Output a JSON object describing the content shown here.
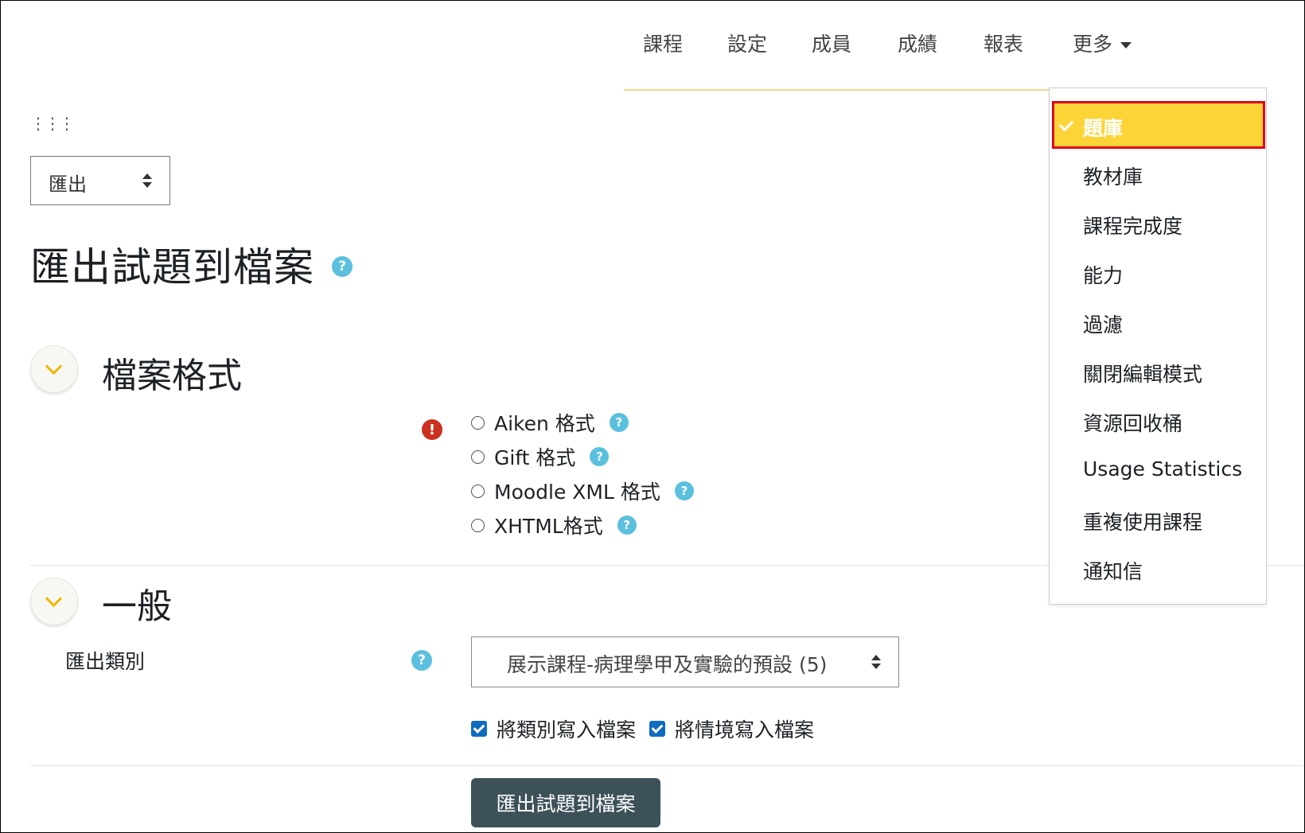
{
  "nav": {
    "items": [
      "課程",
      "設定",
      "成員",
      "成績",
      "報表"
    ],
    "more_label": "更多"
  },
  "selector": {
    "value": "匯出"
  },
  "page_title": "匯出試題到檔案",
  "sections": {
    "format": {
      "title": "檔案格式",
      "options": [
        "Aiken 格式",
        "Gift 格式",
        "Moodle XML 格式",
        "XHTML格式"
      ]
    },
    "general": {
      "title": "一般",
      "category_label": "匯出類別",
      "category_value": "展示課程-病理學甲及實驗的預設 (5)",
      "checkbox_category": "將類別寫入檔案",
      "checkbox_context": "將情境寫入檔案"
    }
  },
  "submit_label": "匯出試題到檔案",
  "dropdown": {
    "active": "題庫",
    "items": [
      "教材庫",
      "課程完成度",
      "能力",
      "過濾",
      "關閉編輯模式",
      "資源回收桶",
      "Usage Statistics",
      "重複使用課程",
      "通知信"
    ]
  },
  "colors": {
    "accent_yellow": "#fdd438",
    "highlight_border": "#e2001a",
    "help_blue": "#5bc0de",
    "error_red": "#ca3120",
    "button_dark": "#3d5159",
    "checkbox_blue": "#0f6cbf"
  },
  "icons": {
    "help": "?",
    "error": "!"
  }
}
